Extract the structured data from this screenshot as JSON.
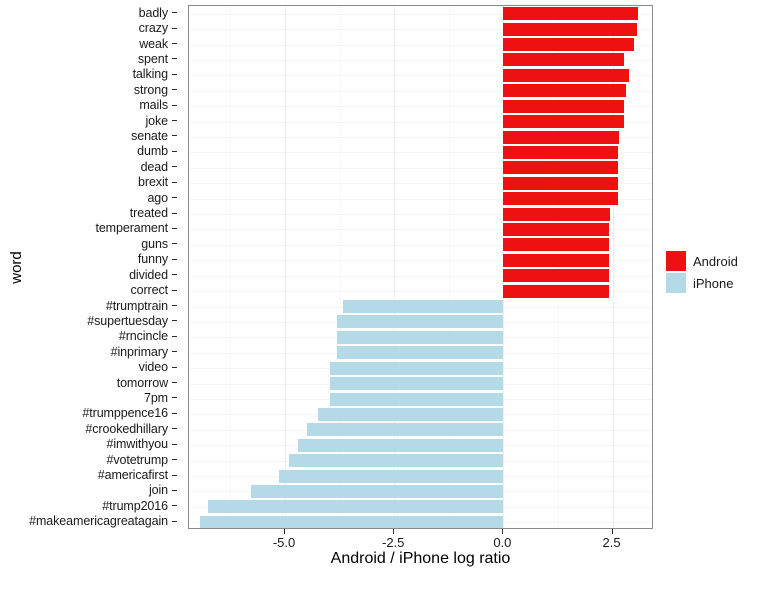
{
  "chart_data": {
    "type": "bar",
    "orientation": "horizontal",
    "title": "",
    "xlabel": "Android / iPhone log ratio",
    "ylabel": "word",
    "xlim": [
      -7.2,
      3.45
    ],
    "ylim": null,
    "grid": true,
    "legend_position": "right",
    "xticks": [
      "-5.0",
      "-2.5",
      "0.0",
      "2.5"
    ],
    "xtick_values": [
      -5.0,
      -2.5,
      0.0,
      2.5
    ],
    "legend": [
      {
        "name": "Android",
        "color": "#ed1111"
      },
      {
        "name": "iPhone",
        "color": "#b4dae7"
      }
    ],
    "categories": [
      "badly",
      "crazy",
      "weak",
      "spent",
      "talking",
      "strong",
      "mails",
      "joke",
      "senate",
      "dumb",
      "dead",
      "brexit",
      "ago",
      "treated",
      "temperament",
      "guns",
      "funny",
      "divided",
      "correct",
      "#trumptrain",
      "#supertuesday",
      "#rncincle",
      "#inprimary",
      "video",
      "tomorrow",
      "7pm",
      "#trumppence16",
      "#crookedhillary",
      "#imwithyou",
      "#votetrump",
      "#americafirst",
      "join",
      "#trump2016",
      "#makeamericagreatagain"
    ],
    "values": [
      3.08,
      3.05,
      3.0,
      2.77,
      2.88,
      2.8,
      2.76,
      2.76,
      2.64,
      2.62,
      2.62,
      2.62,
      2.62,
      2.45,
      2.43,
      2.43,
      2.43,
      2.43,
      2.43,
      -3.68,
      -3.82,
      -3.82,
      -3.82,
      -3.97,
      -3.97,
      -3.97,
      -4.25,
      -4.49,
      -4.7,
      -4.9,
      -5.14,
      -5.79,
      -6.77,
      -6.95
    ],
    "groups": [
      "Android",
      "Android",
      "Android",
      "Android",
      "Android",
      "Android",
      "Android",
      "Android",
      "Android",
      "Android",
      "Android",
      "Android",
      "Android",
      "Android",
      "Android",
      "Android",
      "Android",
      "Android",
      "Android",
      "iPhone",
      "iPhone",
      "iPhone",
      "iPhone",
      "iPhone",
      "iPhone",
      "iPhone",
      "iPhone",
      "iPhone",
      "iPhone",
      "iPhone",
      "iPhone",
      "iPhone",
      "iPhone",
      "iPhone"
    ]
  }
}
